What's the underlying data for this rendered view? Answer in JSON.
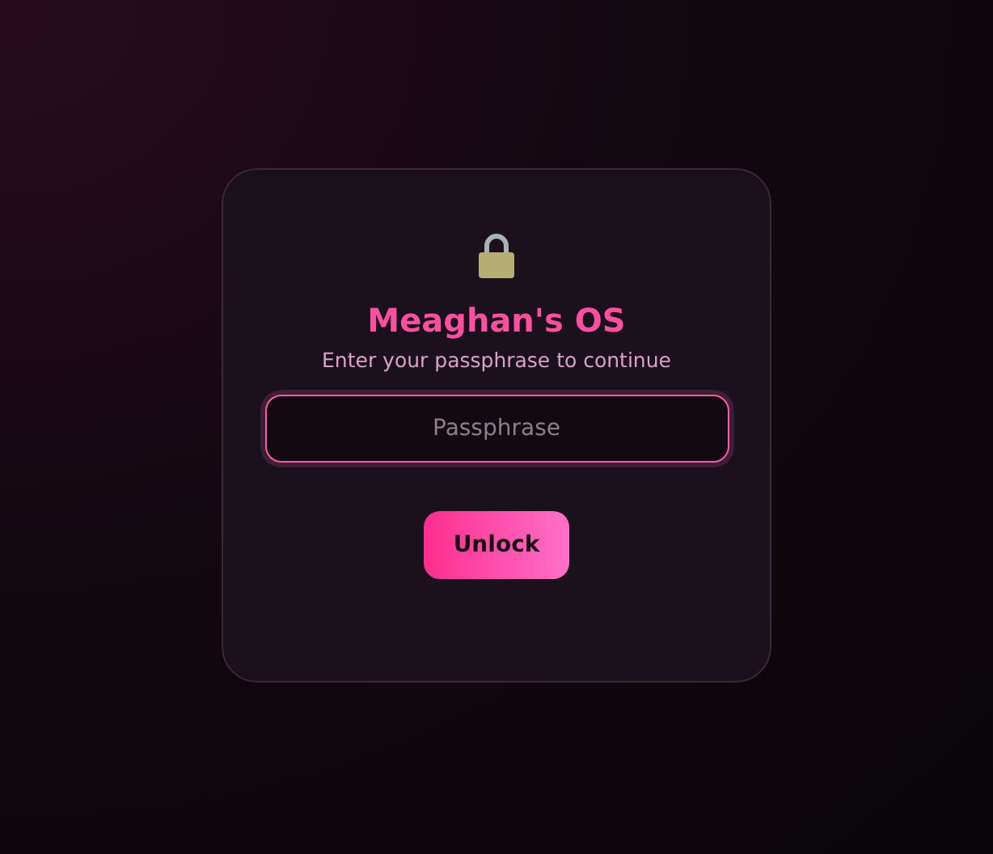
{
  "login": {
    "title": "Meaghan's OS",
    "subtitle": "Enter your passphrase to continue",
    "passphrase_field": {
      "placeholder": "Passphrase",
      "focused": true
    },
    "button": "Unlock"
  }
}
